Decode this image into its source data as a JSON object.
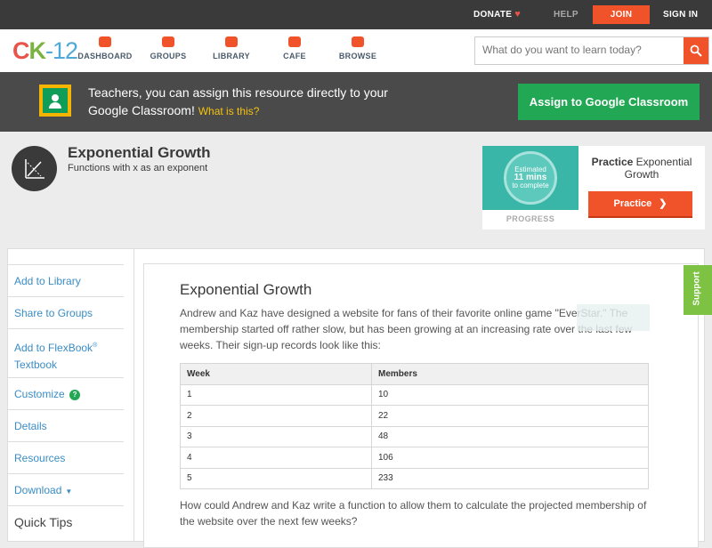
{
  "topbar": {
    "donate": "DONATE",
    "help": "HELP",
    "join": "JOIN",
    "signin": "SIGN IN"
  },
  "nav": {
    "logo": {
      "c": "C",
      "k": "K",
      "num": "-12"
    },
    "items": [
      "DASHBOARD",
      "GROUPS",
      "LIBRARY",
      "CAFE",
      "BROWSE"
    ],
    "search_placeholder": "What do you want to learn today?"
  },
  "banner": {
    "text": "Teachers, you can assign this resource directly to your Google Classroom!",
    "link": "What is this?",
    "button": "Assign to Google Classroom"
  },
  "header": {
    "title": "Exponential Growth",
    "subtitle": "Functions with x as an exponent"
  },
  "practice": {
    "estimated": "Estimated",
    "mins": "11 mins",
    "complete": "to complete",
    "progress_label": "PROGRESS",
    "title_bold": "Practice",
    "title_rest": "Exponential Growth",
    "button": "Practice"
  },
  "sidebar": {
    "add_library": "Add to Library",
    "share_groups": "Share to Groups",
    "add_flexbook": "Add to FlexBook",
    "textbook": "Textbook",
    "customize": "Customize",
    "details": "Details",
    "resources": "Resources",
    "download": "Download",
    "quick_tips": "Quick Tips"
  },
  "content": {
    "title": "Exponential Growth",
    "para1": "Andrew and Kaz have designed a website for fans of their favorite online game \"EverStar.\" The membership started off rather slow, but has been growing at an increasing rate over the last few weeks. Their sign-up records look like this:",
    "table": {
      "headers": [
        "Week",
        "Members"
      ],
      "rows": [
        [
          "1",
          "10"
        ],
        [
          "2",
          "22"
        ],
        [
          "3",
          "48"
        ],
        [
          "4",
          "106"
        ],
        [
          "5",
          "233"
        ]
      ]
    },
    "para2": "How could Andrew and Kaz write a function to allow them to calculate the projected membership of the website over the next few weeks?"
  },
  "support": "Support",
  "colors": {
    "accent": "#f0532a",
    "green": "#22a754",
    "link": "#3a8cc4",
    "dark": "#3a3a3a"
  }
}
